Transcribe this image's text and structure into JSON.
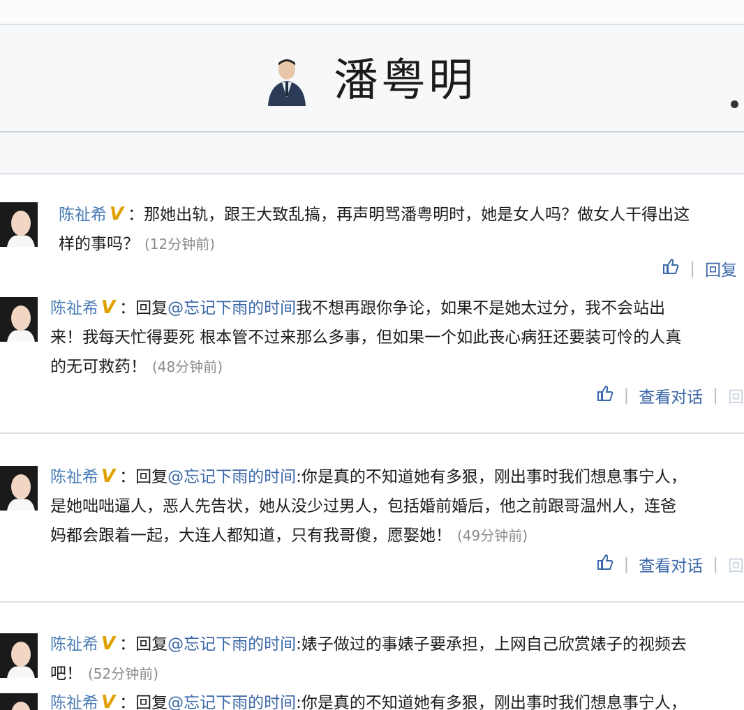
{
  "header": {
    "name": "潘粤明"
  },
  "posts": [
    {
      "user": "陈祉希",
      "v": "V",
      "line1": "：那她出轨，跟王大致乱搞，再声明骂潘粤明时，她是女人吗？做女人干得出这",
      "line2": "样的事吗？",
      "time": "(12分钟前)",
      "reply": "回复"
    },
    {
      "user": "陈祉希",
      "v": "V",
      "prefix": "：回复",
      "mention": "@忘记下雨的时间",
      "line1": "我不想再跟你争论，如果不是她太过分，我不会站出",
      "line2": "来！我每天忙得要死 根本管不过来那么多事，但如果一个如此丧心病狂还要装可怜的人真",
      "line3": "的无可救药！",
      "time": "(48分钟前)",
      "view": "查看对话",
      "reply": "回"
    },
    {
      "user": "陈祉希",
      "v": "V",
      "prefix": "：回复",
      "mention": "@忘记下雨的时间",
      "line1": ":你是真的不知道她有多狠，刚出事时我们想息事宁人，",
      "line2": "是她咄咄逼人，恶人先告状，她从没少过男人，包括婚前婚后，他之前跟哥温州人，连爸",
      "line3": "妈都会跟着一起，大连人都知道，只有我哥傻，愿娶她！",
      "time": "(49分钟前)",
      "view": "查看对话",
      "reply": "回"
    },
    {
      "user": "陈祉希",
      "v": "V",
      "prefix": "：回复",
      "mention": "@忘记下雨的时间",
      "line1": ":婊子做过的事婊子要承担，上网自己欣赏婊子的视频去",
      "line2": "吧！",
      "time": "(52分钟前)"
    },
    {
      "user": "陈祉希",
      "v": "V",
      "prefix": "：回复",
      "mention": "@忘记下雨的时间",
      "line1": ":你是真的不知道她有多狠，刚出事时我们想息事宁人，"
    }
  ],
  "icons": {
    "like": "thumbs-up-icon"
  },
  "colors": {
    "link": "#3b67a7",
    "vbadge": "#e0a100",
    "timestamp": "#8a8a8a"
  }
}
